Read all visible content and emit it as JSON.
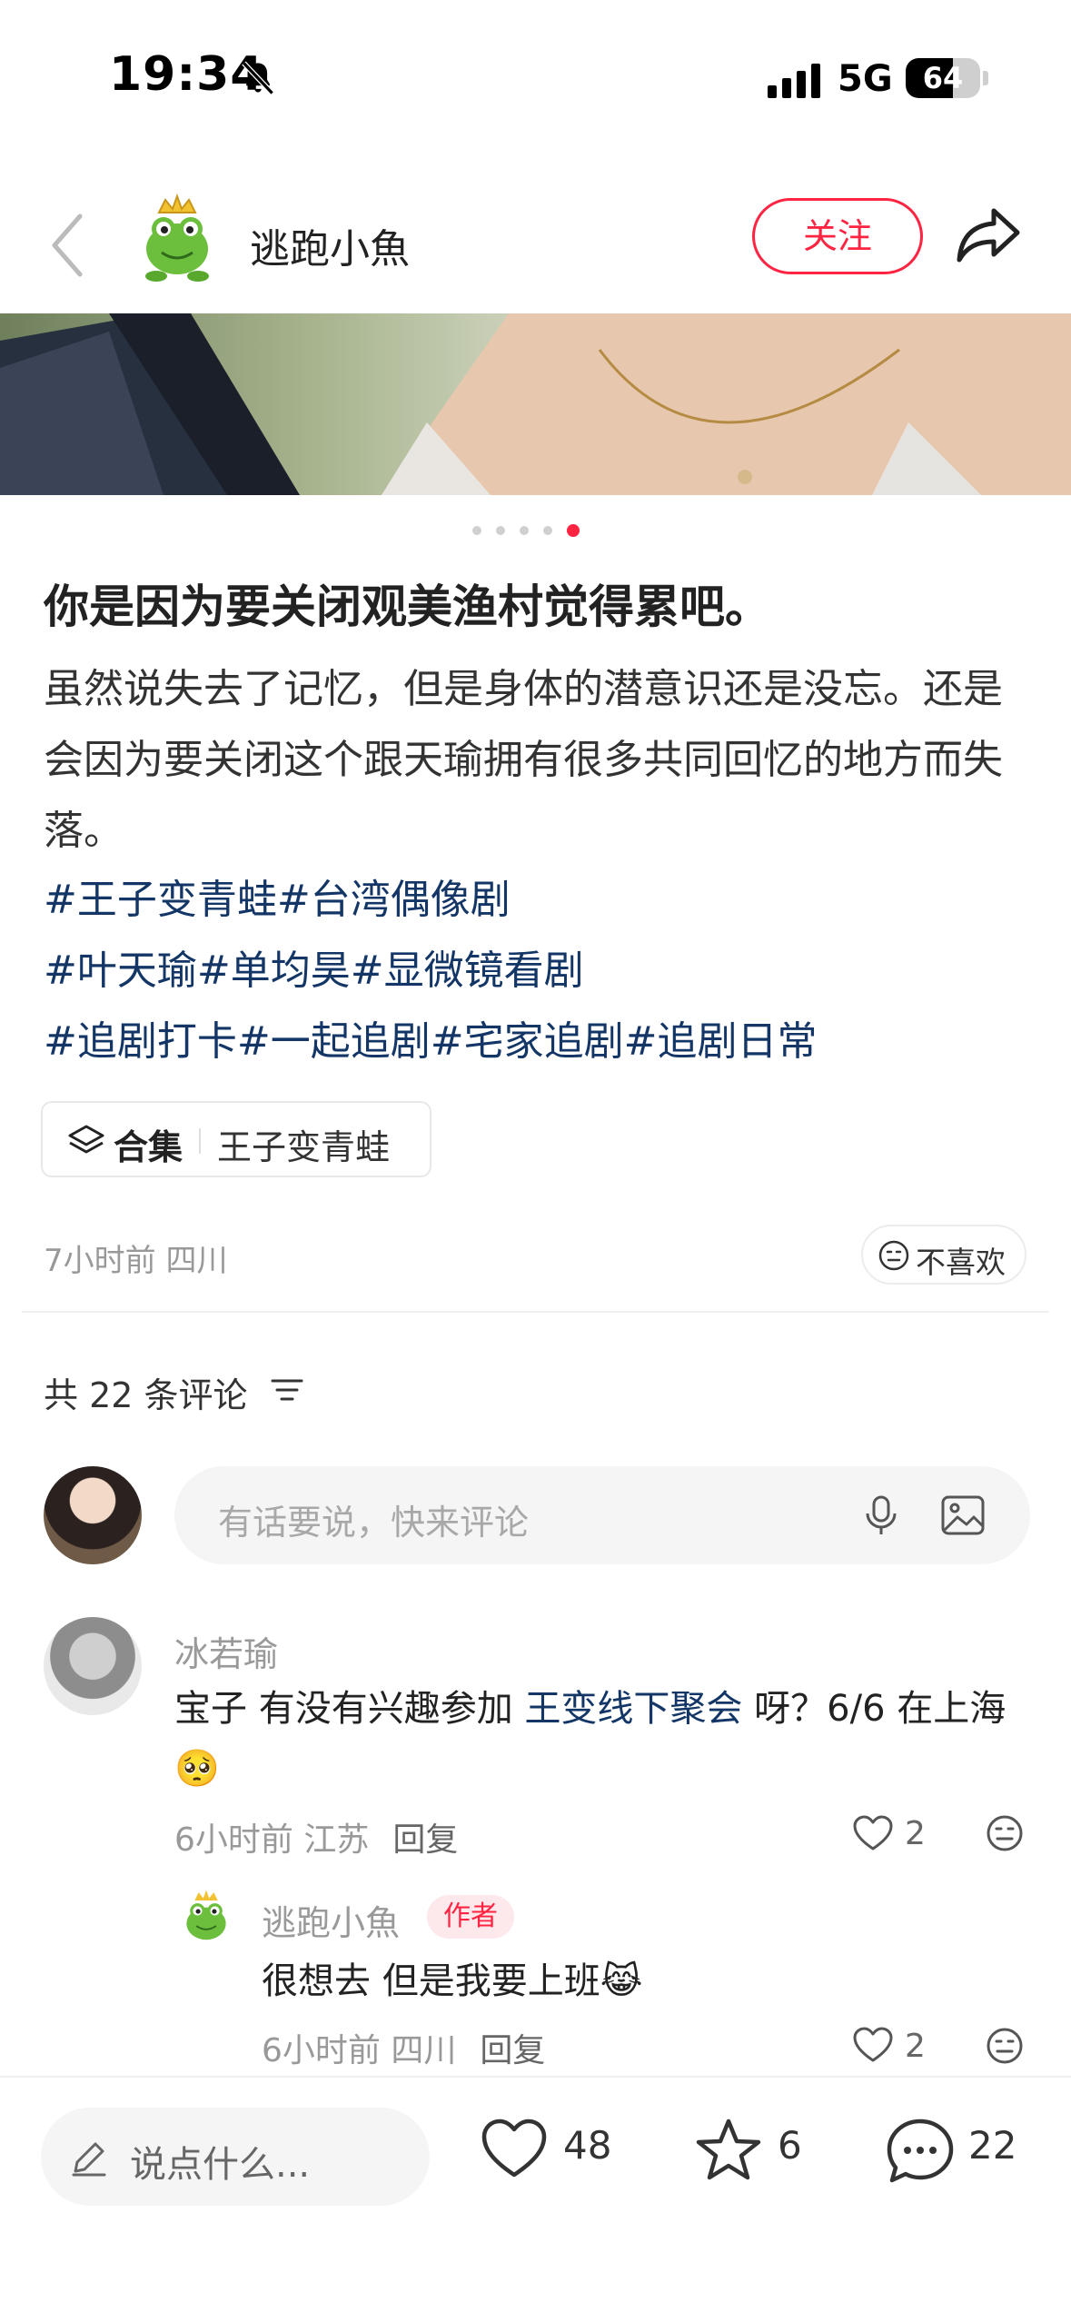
{
  "status_bar": {
    "time": "19:34",
    "network": "5G",
    "battery": "64",
    "battery_level": 0.64,
    "icons": [
      "bell-muted-icon",
      "signal-bars-icon",
      "battery-icon"
    ]
  },
  "header": {
    "author_name": "逃跑小魚",
    "follow_label": "关注",
    "icons": [
      "back-chevron-icon",
      "share-arrow-icon"
    ]
  },
  "carousel": {
    "page_count": 5,
    "active_index": 4
  },
  "post": {
    "title": "你是因为要关闭观美渔村觉得累吧。",
    "body": "虽然说失去了记忆，但是身体的潜意识还是没忘。还是会因为要关闭这个跟天瑜拥有很多共同回忆的地方而失落。",
    "tag_lines": [
      [
        "#王子变青蛙",
        "#台湾偶像剧"
      ],
      [
        "#叶天瑜",
        "#单均昊",
        "#显微镜看剧"
      ],
      [
        "#追剧打卡",
        "#一起追剧",
        "#宅家追剧",
        "#追剧日常"
      ]
    ],
    "collection_label": "合集",
    "collection_name": "王子变青蛙",
    "meta": "7小时前 四川",
    "dislike_label": "不喜欢"
  },
  "comments_section": {
    "count_label": "共 22 条评论",
    "input_placeholder": "有话要说，快来评论"
  },
  "comments": [
    {
      "user": "冰若瑜",
      "text_before": "宝子 有没有兴趣参加 ",
      "link": "王变线下聚会",
      "text_after": " 呀？6/6 在上海🥺",
      "meta": "6小时前 江苏",
      "reply_label": "回复",
      "likes": "2"
    },
    {
      "user": "逃跑小魚",
      "badge": "作者",
      "text": "很想去 但是我要上班😹",
      "meta": "6小时前 四川",
      "reply_label": "回复",
      "likes": "2"
    }
  ],
  "bottom_bar": {
    "say_placeholder": "说点什么...",
    "likes": "48",
    "stars": "6",
    "comments": "22"
  },
  "colors": {
    "accent": "#ff2442",
    "tag_blue": "#133667",
    "muted": "#999999"
  }
}
